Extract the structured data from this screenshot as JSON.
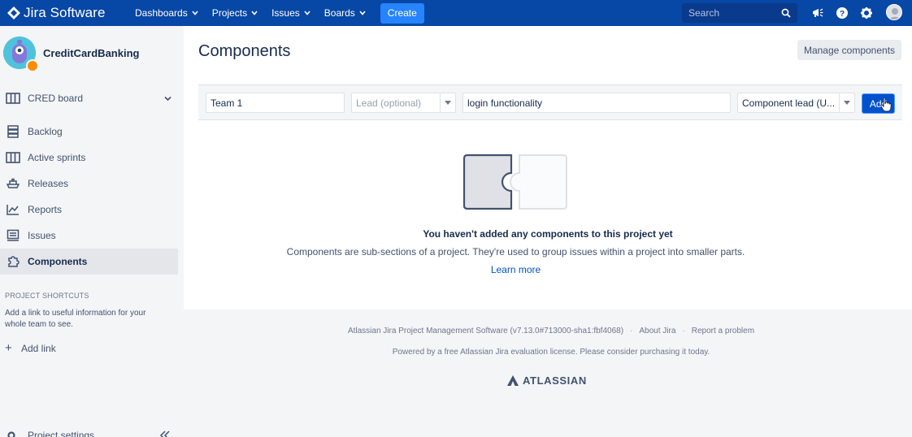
{
  "topnav": {
    "product": "Jira Software",
    "menus": [
      {
        "label": "Dashboards"
      },
      {
        "label": "Projects"
      },
      {
        "label": "Issues"
      },
      {
        "label": "Boards"
      }
    ],
    "create_label": "Create",
    "search_placeholder": "Search",
    "colors": {
      "bar": "#0747a6",
      "create": "#2684ff"
    }
  },
  "sidebar": {
    "project_name": "CreditCardBanking",
    "board_label": "CRED board",
    "items": [
      {
        "label": "Backlog",
        "icon": "backlog-icon"
      },
      {
        "label": "Active sprints",
        "icon": "board-columns-icon"
      },
      {
        "label": "Releases",
        "icon": "ship-icon"
      },
      {
        "label": "Reports",
        "icon": "chart-line-icon"
      },
      {
        "label": "Issues",
        "icon": "issues-icon"
      },
      {
        "label": "Components",
        "icon": "puzzle-icon",
        "active": true
      }
    ],
    "shortcuts_heading": "PROJECT SHORTCUTS",
    "shortcuts_desc": "Add a link to useful information for your whole team to see.",
    "add_link_label": "Add link",
    "settings_label": "Project settings"
  },
  "main": {
    "title": "Components",
    "manage_button": "Manage components",
    "form": {
      "name_value": "Team 1",
      "lead_placeholder": "Lead (optional)",
      "description_value": "login functionality",
      "assignee_value": "Component lead (U...",
      "add_label": "Add"
    },
    "empty": {
      "title": "You haven't added any components to this project yet",
      "description": "Components are sub-sections of a project. They're used to group issues within a project into smaller parts.",
      "learn_more": "Learn more"
    }
  },
  "footer": {
    "version_text": "Atlassian Jira Project Management Software (v7.13.0#713000-sha1:fbf4068)",
    "about": "About Jira",
    "report": "Report a problem",
    "license_text": "Powered by a free Atlassian Jira evaluation license. Please consider purchasing it today.",
    "brand": "ATLASSIAN"
  }
}
